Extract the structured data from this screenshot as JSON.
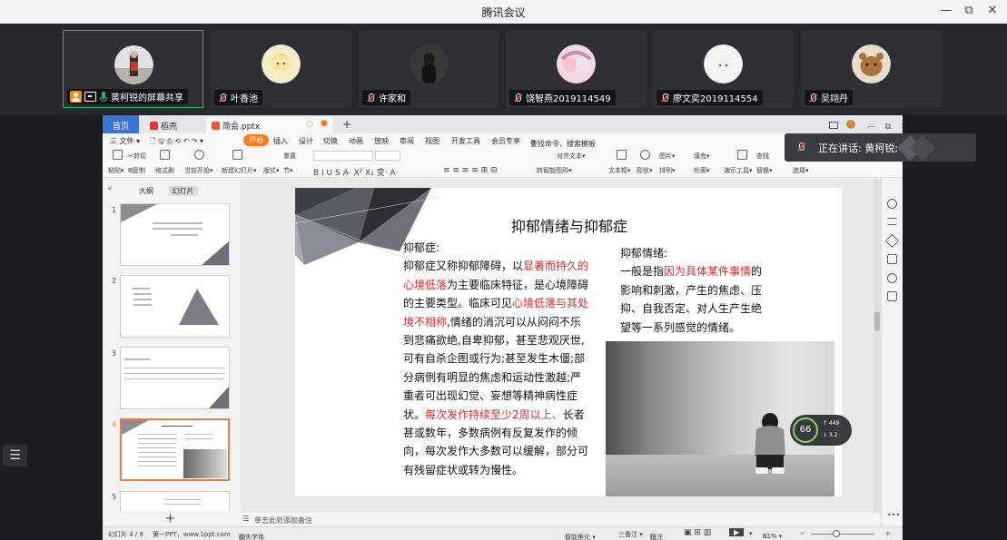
{
  "window": {
    "title": "腾讯会议",
    "controls": [
      "—",
      "⧉",
      "✕"
    ]
  },
  "participants": [
    {
      "name": "黄柯锐的屏幕共享",
      "active": true
    },
    {
      "name": "叶香池"
    },
    {
      "name": "许家和"
    },
    {
      "name": "饶智燕2019114549"
    },
    {
      "name": "廖文奕2019114554"
    },
    {
      "name": "吴翊丹"
    }
  ],
  "speaker": {
    "label": "正在讲话: 黄柯锐;"
  },
  "wps": {
    "tabs": {
      "home": "首页",
      "shell": "稻壳",
      "doc": "简会.pptx",
      "add": "+"
    },
    "menu": {
      "file": "三 文件 ▾",
      "start": "开始",
      "items": [
        "插入",
        "设计",
        "切换",
        "动画",
        "放映",
        "审阅",
        "视图",
        "开发工具",
        "会员专享"
      ],
      "search": "查找命令、搜索模板"
    },
    "ribbon": {
      "paste": "粘贴▾",
      "cut": "剪切",
      "copy": "复制",
      "format": "格式刷",
      "from_current": "当前开始▾",
      "new_slide": "新建幻灯片▾",
      "layout": "版式▾",
      "section": "节▾",
      "reset": "重置",
      "textbox": "文本框▾",
      "shape": "形状▾",
      "arrange": "排列▾",
      "picture": "图片▾",
      "fill": "填充▾",
      "outline": "轮廓▾",
      "present_tools": "演示工具▾",
      "replace": "替换▾",
      "select": "选择▾",
      "find": "查找",
      "align_text": "对齐文本▾",
      "smartart": "转智能图形▾"
    },
    "leftpane": {
      "outline": "大纲",
      "slides": "幻灯片",
      "nums": [
        "1",
        "2",
        "3",
        "4",
        "5"
      ],
      "add": "+"
    },
    "slide": {
      "title": "抑郁情绪与抑郁症",
      "left_heading": "抑郁症:",
      "left_parts": [
        "抑郁症又称抑郁障碍，以",
        "显著而持久的心境低落",
        "为主要临床特征，是心境障碍的主要类型。临床可见",
        "心境低落与其处境不相称",
        ",情绪的消沉可以从闷闷不乐到悲痛欲绝,自卑抑郁，甚至悲观厌世,可有自杀企图或行为;甚至发生木僵;部分病例有明显的焦虑和运动性激越;严重者可出现幻觉、妄想等精神病性症状。",
        "每次发作持续至少2周以上、",
        "长者甚或数年，多数病例有反复发作的倾向，每次发作大多数可以缓解，部分可有残留症状或转为慢性。"
      ],
      "right_heading": "抑郁情绪:",
      "right_parts": [
        "一般是指",
        "因为具体某件事情",
        "的影响和刺激，产生的焦虑、压抑、自我否定、对人生产生绝望等一系列感觉的情绪。"
      ]
    },
    "notes": "单击此处添加备注",
    "status": {
      "slide_info": "幻灯片 4 / 8",
      "template": "第一PPT，www.1ppt.com",
      "missing_font": "缺失字体",
      "beautify": "智能美化 ▾",
      "notes_btn": "三备注 ▾",
      "comments": "批注",
      "zoom": "81% ▾"
    }
  },
  "network": {
    "score": "66",
    "up": "↑ 449",
    "down": "↓ 3.2"
  },
  "colors": {
    "accent_orange": "#ff7a1a",
    "wps_blue": "#3a74d6",
    "active_border": "#2bb673",
    "highlight_red": "#e02828"
  }
}
